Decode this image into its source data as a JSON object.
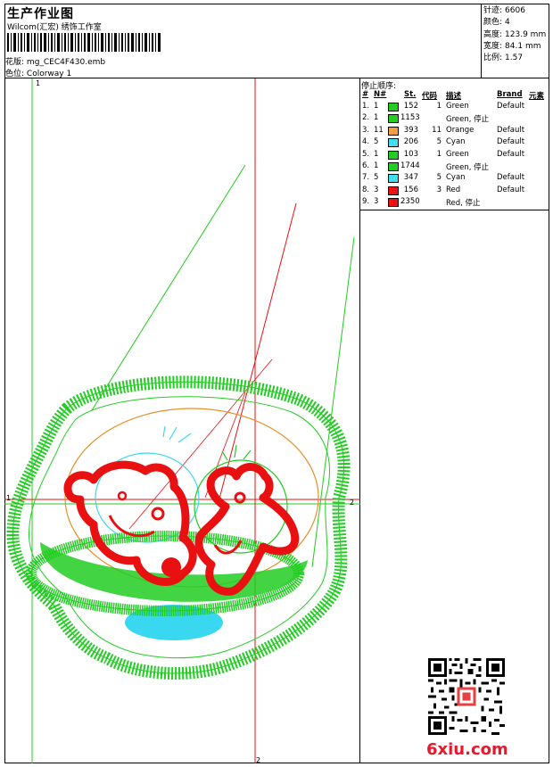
{
  "header": {
    "title": "生产作业图",
    "company": "Wilcom(汇宏) 绣饰工作室",
    "pattern_label": "花版:",
    "pattern_value": "mg_CEC4F430.emb",
    "colorway_label": "色位:",
    "colorway_value": "Colorway 1"
  },
  "stats": {
    "stitches_label": "针迹:",
    "stitches_value": "6606",
    "colors_label": "颜色:",
    "colors_value": "4",
    "height_label": "高度:",
    "height_value": "123.9 mm",
    "width_label": "宽度:",
    "width_value": "84.1 mm",
    "ratio_label": "比例:",
    "ratio_value": "1.57"
  },
  "stop_sequence": {
    "title": "停止顺序:",
    "headers": {
      "num": "#",
      "n": "N#",
      "st": "St.",
      "code": "代码",
      "desc": "描述",
      "brand": "Brand",
      "element": "元素"
    },
    "rows": [
      {
        "num": "1.",
        "n": "1",
        "color": "#22cc22",
        "st": "152",
        "code": "1",
        "desc": "Green",
        "brand": "Default"
      },
      {
        "num": "2.",
        "n": "1",
        "color": "#22cc22",
        "st": "1153",
        "code": "",
        "desc": "Green, 停止",
        "brand": ""
      },
      {
        "num": "3.",
        "n": "11",
        "color": "#f0a040",
        "st": "393",
        "code": "11",
        "desc": "Orange",
        "brand": "Default"
      },
      {
        "num": "4.",
        "n": "5",
        "color": "#40e0f0",
        "st": "206",
        "code": "5",
        "desc": "Cyan",
        "brand": "Default"
      },
      {
        "num": "5.",
        "n": "1",
        "color": "#22cc22",
        "st": "103",
        "code": "1",
        "desc": "Green",
        "brand": "Default"
      },
      {
        "num": "6.",
        "n": "1",
        "color": "#22cc22",
        "st": "1744",
        "code": "",
        "desc": "Green, 停止",
        "brand": ""
      },
      {
        "num": "7.",
        "n": "5",
        "color": "#40e0f0",
        "st": "347",
        "code": "5",
        "desc": "Cyan",
        "brand": "Default"
      },
      {
        "num": "8.",
        "n": "3",
        "color": "#ee1111",
        "st": "156",
        "code": "3",
        "desc": "Red",
        "brand": "Default"
      },
      {
        "num": "9.",
        "n": "3",
        "color": "#ee1111",
        "st": "2350",
        "code": "",
        "desc": "Red, 停止",
        "brand": ""
      }
    ]
  },
  "axes": {
    "left_v": "1",
    "top_h": "1",
    "right_h": "2",
    "bottom_v": "2"
  },
  "watermark": {
    "text": "6xiu.com"
  },
  "colors": {
    "green": "#22cc22",
    "orange": "#e8902a",
    "cyan": "#3ad8f0",
    "red": "#e81010"
  }
}
